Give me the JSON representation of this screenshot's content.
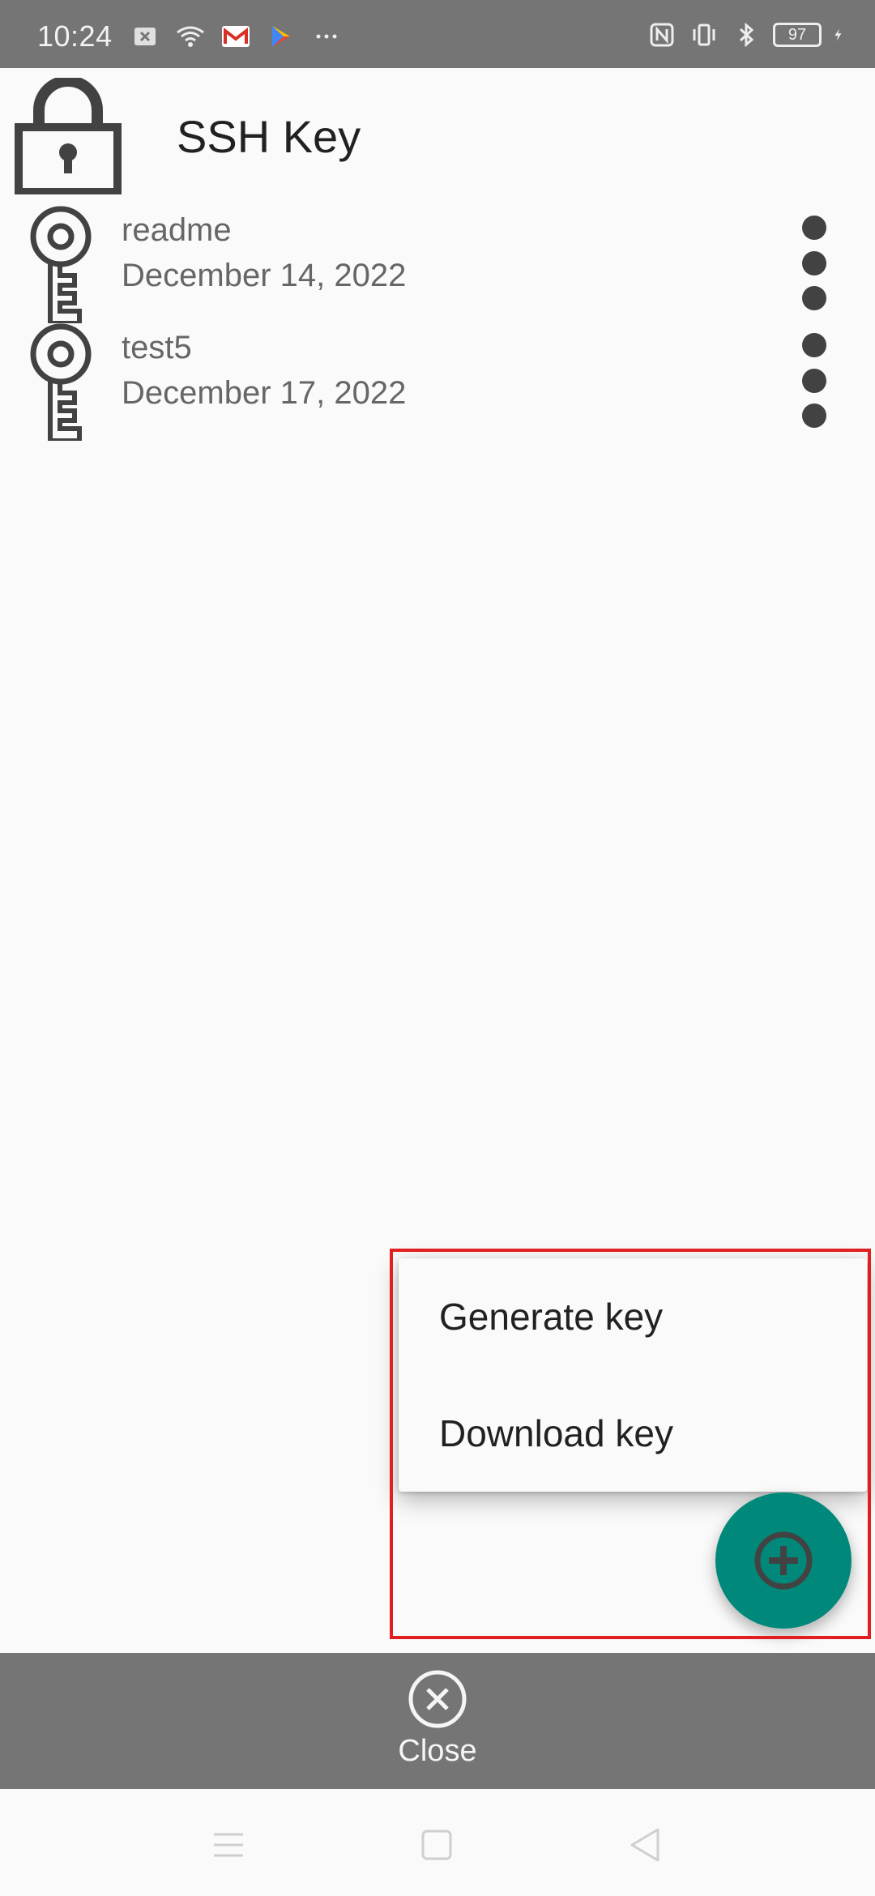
{
  "status_bar": {
    "time": "10:24",
    "battery": "97",
    "icons": [
      "notification-icon",
      "wifi-icon",
      "gmail-icon",
      "play-store-icon",
      "more-notifications-icon",
      "nfc-icon",
      "vibrate-icon",
      "bluetooth-icon",
      "battery-icon",
      "charging-icon"
    ]
  },
  "header": {
    "title": "SSH Key",
    "icon": "lock-icon"
  },
  "keys": [
    {
      "name": "readme",
      "date": "December 14, 2022"
    },
    {
      "name": "test5",
      "date": "December 17, 2022"
    }
  ],
  "menu": {
    "generate_label": "Generate key",
    "download_label": "Download key"
  },
  "fab": {
    "icon": "add-circle-icon",
    "color": "#00897b"
  },
  "close_bar": {
    "label": "Close",
    "icon": "close-circle-icon"
  },
  "highlight_color": "#e02020",
  "nav": [
    "menu-icon",
    "home-icon",
    "back-icon"
  ]
}
